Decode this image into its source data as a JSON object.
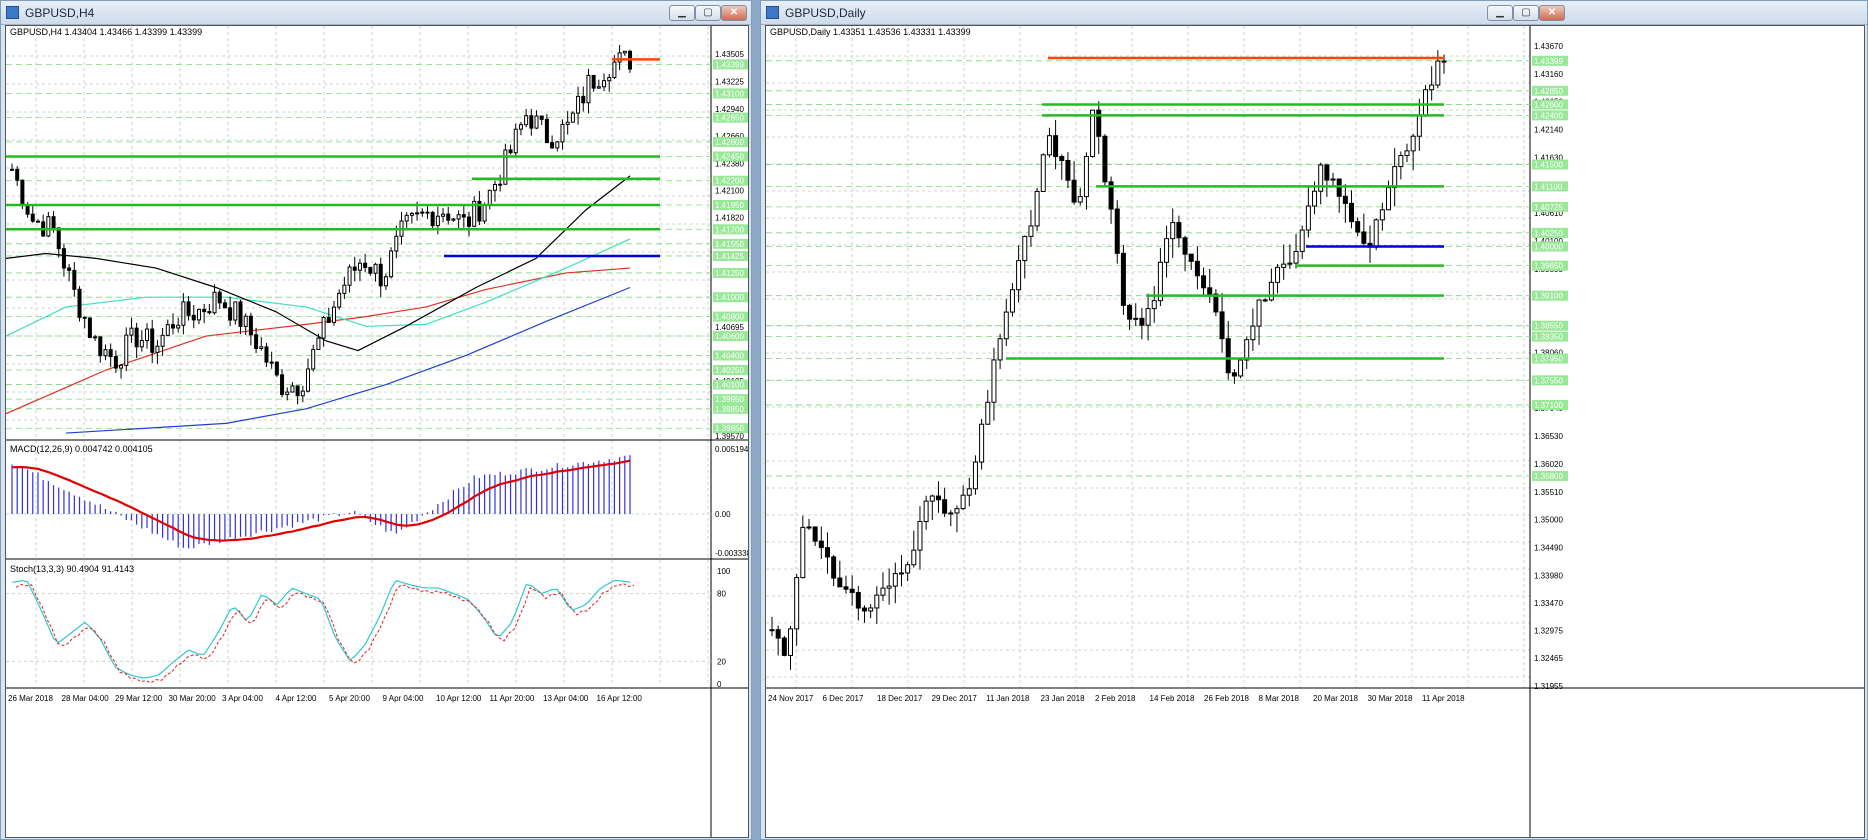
{
  "left_window": {
    "title": "GBPUSD,H4",
    "chart_header": "GBPUSD,H4  1.43404 1.43466 1.43399 1.43399",
    "macd_header": "MACD(12,26,9) 0.004742 0.004105",
    "stoch_header": "Stoch(13,3,3) 90.4904 91.4143",
    "price_axis_labels": [
      "1.43505",
      "1.43225",
      "1.42940",
      "1.42660",
      "1.42380",
      "1.42100",
      "1.41820",
      "1.41545",
      "1.41265",
      "1.40985",
      "1.40695",
      "1.40420",
      "1.40135",
      "1.39855",
      "1.39570"
    ],
    "highlight_labels": [
      "1.43399",
      "1.43100",
      "1.42850",
      "1.42600",
      "1.42450",
      "1.42200",
      "1.41950",
      "1.41700",
      "1.41550",
      "1.41425",
      "1.41250",
      "1.41000",
      "1.40800",
      "1.40600",
      "1.40400",
      "1.40250",
      "1.40100",
      "1.39950",
      "1.39850",
      "1.39650"
    ],
    "macd_axis_labels": [
      "0.005194",
      "0.00",
      "-0.003338"
    ],
    "stoch_axis_labels": [
      "100",
      "80",
      "20",
      "0"
    ],
    "time_labels": [
      "26 Mar 2018",
      "28 Mar 04:00",
      "29 Mar 12:00",
      "30 Mar 20:00",
      "3 Apr 04:00",
      "4 Apr 12:00",
      "5 Apr 20:00",
      "9 Apr 04:00",
      "10 Apr 12:00",
      "11 Apr 20:00",
      "13 Apr 04:00",
      "16 Apr 12:00"
    ]
  },
  "right_window": {
    "title": "GBPUSD,Daily",
    "chart_header": "GBPUSD,Daily  1.43351 1.43536 1.43331 1.43399",
    "price_axis_labels": [
      "1.43670",
      "1.43160",
      "1.42650",
      "1.42140",
      "1.41630",
      "1.41120",
      "1.40610",
      "1.40100",
      "1.39590",
      "1.39080",
      "1.38570",
      "1.38060",
      "1.37550",
      "1.37040",
      "1.36530",
      "1.36020",
      "1.35510",
      "1.35000",
      "1.34490",
      "1.33980",
      "1.33470",
      "1.32975",
      "1.32465",
      "1.31955"
    ],
    "highlight_labels": [
      "1.43399",
      "1.42850",
      "1.42600",
      "1.42400",
      "1.41500",
      "1.41100",
      "1.40725",
      "1.40250",
      "1.40000",
      "1.39650",
      "1.39100",
      "1.38550",
      "1.38350",
      "1.37950",
      "1.37550",
      "1.37100",
      "1.35800"
    ],
    "time_labels": [
      "24 Nov 2017",
      "6 Dec 2017",
      "18 Dec 2017",
      "29 Dec 2017",
      "11 Jan 2018",
      "23 Jan 2018",
      "2 Feb 2018",
      "14 Feb 2018",
      "26 Feb 2018",
      "8 Mar 2018",
      "20 Mar 2018",
      "30 Mar 2018",
      "11 Apr 2018"
    ]
  },
  "colors": {
    "bull": "#ffffff",
    "bear": "#000000",
    "support_line": "#22bb22",
    "resistance_top": "#ff4500",
    "blue_line": "#0000dd",
    "grid": "#c8d8c8",
    "highlight_bg": "#98e898",
    "ma_black": "#000000",
    "ma_green": "#40e0c0",
    "ma_red": "#e03020",
    "ma_blue": "#2040d0",
    "macd_hist": "#3030e0",
    "macd_signal": "#e00000",
    "stoch_main": "#30c8d0",
    "stoch_signal": "#e03030"
  },
  "chart_data": [
    {
      "type": "candlestick",
      "title": "GBPUSD,H4",
      "ylim": [
        1.3957,
        1.4365
      ],
      "horizontal_levels": [
        {
          "value": 1.4345,
          "color": "orange-red",
          "label": ""
        },
        {
          "value": 1.4245,
          "color": "green"
        },
        {
          "value": 1.4222,
          "color": "green"
        },
        {
          "value": 1.4195,
          "color": "green"
        },
        {
          "value": 1.417,
          "color": "green"
        },
        {
          "value": 1.41425,
          "color": "blue"
        }
      ],
      "moving_averages": [
        "black",
        "turquoise",
        "red",
        "blue"
      ],
      "indicators": [
        {
          "type": "histogram+line",
          "name": "MACD(12,26,9)",
          "values": [
            0.004742,
            0.004105
          ],
          "ylim": [
            -0.003338,
            0.005194
          ]
        },
        {
          "type": "line",
          "name": "Stoch(13,3,3)",
          "values": [
            90.4904,
            91.4143
          ],
          "ylim": [
            0,
            100
          ],
          "levels": [
            20,
            80
          ]
        }
      ]
    },
    {
      "type": "candlestick",
      "title": "GBPUSD,Daily",
      "ylim": [
        1.31955,
        1.4367
      ],
      "horizontal_levels": [
        {
          "value": 1.4345,
          "color": "orange-red"
        },
        {
          "value": 1.426,
          "color": "green"
        },
        {
          "value": 1.424,
          "color": "green"
        },
        {
          "value": 1.411,
          "color": "green"
        },
        {
          "value": 1.4,
          "color": "blue"
        },
        {
          "value": 1.3965,
          "color": "green"
        },
        {
          "value": 1.391,
          "color": "green"
        },
        {
          "value": 1.3795,
          "color": "green"
        }
      ]
    }
  ]
}
